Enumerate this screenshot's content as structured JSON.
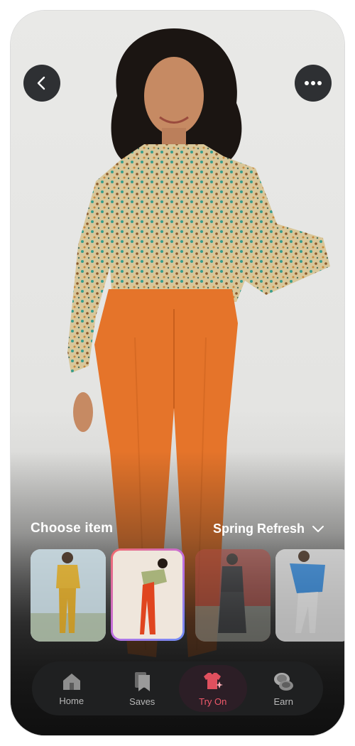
{
  "header": {
    "back_icon": "chevron-left-icon",
    "more_icon": "more-horizontal-icon"
  },
  "picker": {
    "title": "Choose item",
    "collection": "Spring Refresh",
    "collection_icon": "chevron-down-icon",
    "selected_index": 1
  },
  "nav": {
    "items": [
      {
        "label": "Home",
        "icon": "home-icon"
      },
      {
        "label": "Saves",
        "icon": "bookmark-icon"
      },
      {
        "label": "Try On",
        "icon": "shirt-sparkle-icon"
      },
      {
        "label": "Earn",
        "icon": "coins-icon"
      }
    ],
    "active_index": 2,
    "active_color": "#f0596b"
  }
}
